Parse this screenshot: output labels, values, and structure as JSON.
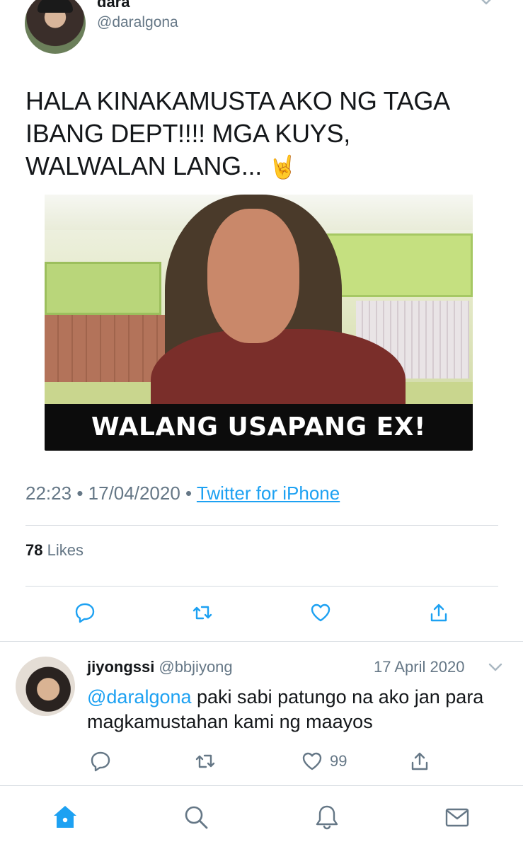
{
  "tweet": {
    "author_name": "dara",
    "author_handle": "@daralgona",
    "text": "HALA KINAKAMUSTA AKO NG TAGA IBANG DEPT!!!! MGA KUYS, WALWALAN LANG... ",
    "emoji": "🤘",
    "media_caption": "WALANG USAPANG EX!",
    "time": "22:23",
    "separator": "•",
    "date": "17/04/2020",
    "source": "Twitter for iPhone",
    "likes_count": "78",
    "likes_label": "Likes"
  },
  "reply": {
    "author_name": "jiyongssi",
    "author_handle": "@bbjiyong",
    "date": "17 April 2020",
    "mention": "@daralgona",
    "text": " paki sabi patungo na ako jan para magkamustahan kami ng maayos",
    "like_count": "99"
  },
  "colors": {
    "accent": "#1da1f2",
    "secondary_text": "#657786",
    "divider": "#d6dbe0",
    "icon": "#1da1f2"
  },
  "icons": {
    "main_actions": [
      "reply-icon",
      "retweet-icon",
      "like-icon",
      "share-icon"
    ],
    "nav": [
      "home-icon",
      "search-icon",
      "notifications-icon",
      "messages-icon"
    ]
  }
}
